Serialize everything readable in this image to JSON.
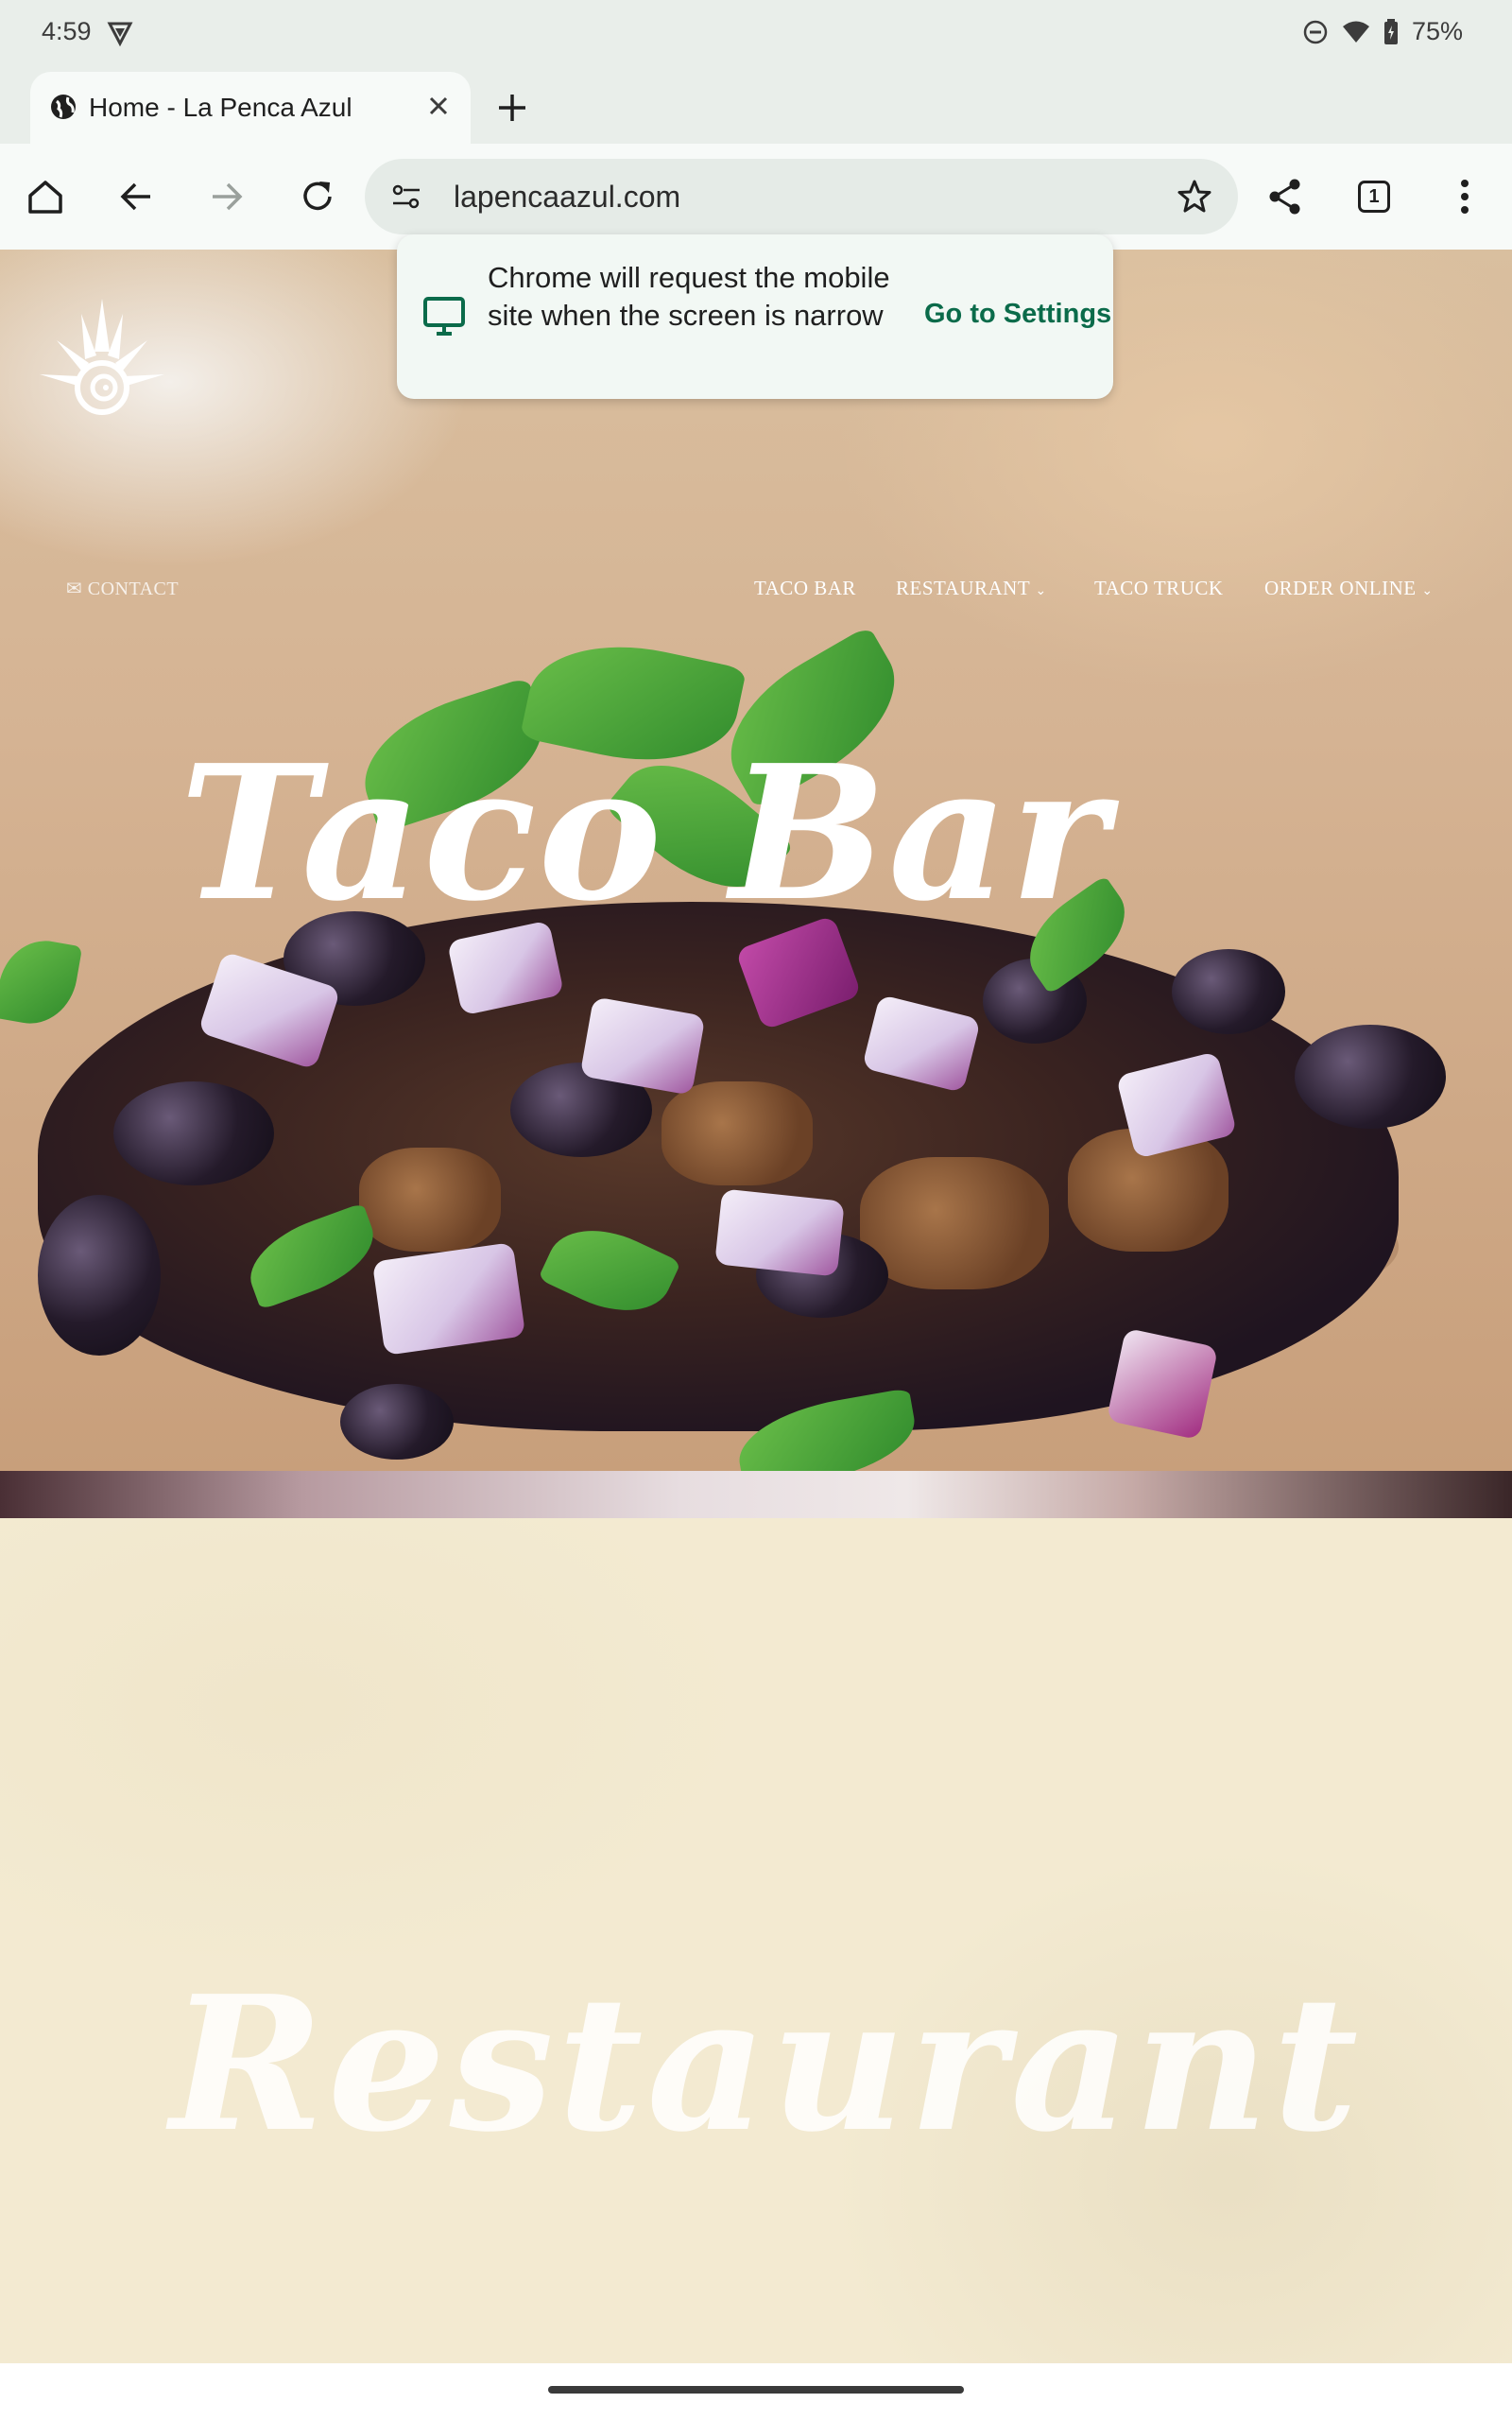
{
  "status_bar": {
    "time": "4:59",
    "battery": "75%"
  },
  "tab": {
    "title": "Home - La Penca Azul"
  },
  "omnibox": {
    "url": "lapencaazul.com",
    "tab_count": "1"
  },
  "popup": {
    "message": "Chrome will request the mobile site when the screen is narrow",
    "action": "Go to Settings"
  },
  "site": {
    "nav": {
      "contact": "CONTACT",
      "items": [
        "TACO BAR",
        "RESTAURANT",
        "TACO TRUCK",
        "ORDER ONLINE"
      ]
    },
    "hero_title": "Taco Bar",
    "section_title": "Restaurant"
  },
  "colors": {
    "accent": "#0b6b4a",
    "chrome_bg": "#e9eeea",
    "cream": "#f3ead1"
  }
}
